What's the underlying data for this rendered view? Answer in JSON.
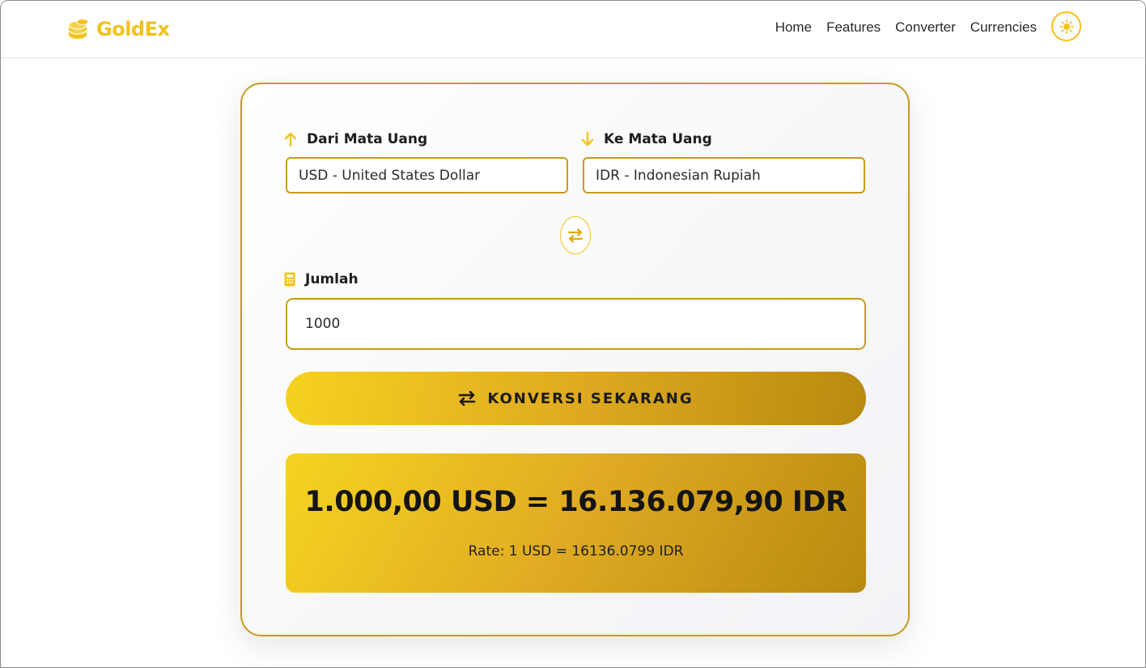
{
  "brand": {
    "name": "GoldEx",
    "icon": "coins-icon",
    "accent_color": "#f2c21c",
    "border_gold": "#c99a1c"
  },
  "nav": {
    "links": [
      {
        "label": "Home"
      },
      {
        "label": "Features"
      },
      {
        "label": "Converter"
      },
      {
        "label": "Currencies"
      }
    ],
    "theme_toggle_icon": "sun-icon"
  },
  "converter": {
    "from_label": "Dari Mata Uang",
    "from_value": "USD - United States Dollar",
    "to_label": "Ke Mata Uang",
    "to_value": "IDR - Indonesian Rupiah",
    "swap_icon": "swap-arrows-icon",
    "amount_label": "Jumlah",
    "amount_value": "1000",
    "convert_button_label": "KONVERSI SEKARANG"
  },
  "result": {
    "main": "1.000,00 USD = 16.136.079,90 IDR",
    "rate": "Rate: 1 USD = 16136.0799 IDR"
  }
}
